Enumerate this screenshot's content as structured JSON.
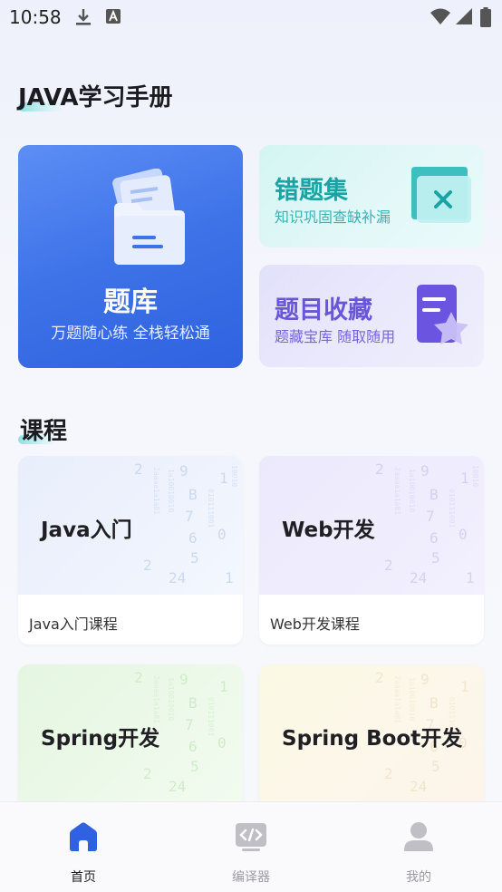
{
  "status_bar": {
    "time": "10:58",
    "icons": [
      "download-icon",
      "font-a-icon",
      "wifi-icon",
      "signal-icon",
      "battery-icon"
    ]
  },
  "page": {
    "title": "JAVA学习手册"
  },
  "feature_cards": {
    "question_bank": {
      "title": "题库",
      "subtitle": "万题随心练 全栈轻松通"
    },
    "wrong_questions": {
      "title": "错题集",
      "subtitle": "知识巩固查缺补漏"
    },
    "favorites": {
      "title": "题目收藏",
      "subtitle": "题藏宝库 随取随用"
    }
  },
  "courses_section": {
    "title": "课程",
    "items": [
      {
        "name": "Java入门",
        "desc": "Java入门课程"
      },
      {
        "name": "Web开发",
        "desc": "Web开发课程"
      },
      {
        "name": "Spring开发",
        "desc": ""
      },
      {
        "name": "Spring Boot开发",
        "desc": ""
      }
    ]
  },
  "bottom_nav": {
    "items": [
      {
        "label": "首页",
        "icon": "home-icon",
        "active": true
      },
      {
        "label": "编译器",
        "icon": "code-icon",
        "active": false
      },
      {
        "label": "我的",
        "icon": "user-icon",
        "active": false
      }
    ]
  },
  "colors": {
    "accent": "#2f62e0",
    "teal": "#1aa3a4",
    "purple": "#6a55d8",
    "nav_inactive": "#9b9ba3"
  }
}
